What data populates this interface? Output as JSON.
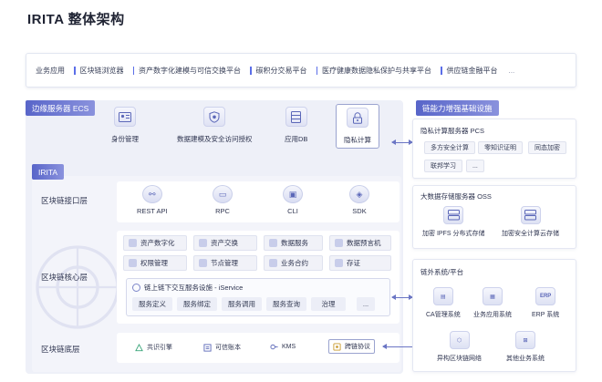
{
  "title": "IRITA 整体架构",
  "business": {
    "label": "业务应用",
    "items": [
      "区块链浏览器",
      "资产数字化建模与可信交换平台",
      "碳积分交易平台",
      "医疗健康数据隐私保护与共享平台",
      "供应链金融平台"
    ],
    "more": "..."
  },
  "ecs": {
    "header": "边缘服务器 ECS",
    "items": [
      "身份管理",
      "数据建模及安全访问授权",
      "应用DB",
      "隐私计算"
    ]
  },
  "irita": {
    "header": "IRITA",
    "api_layer": {
      "label": "区块链接口层",
      "items": [
        "REST API",
        "RPC",
        "CLI",
        "SDK"
      ]
    },
    "core_layer": {
      "label": "区块链核心层",
      "chips": [
        "资产数字化",
        "资产交换",
        "数据服务",
        "数据预言机",
        "权限管理",
        "节点管理",
        "业务合约",
        "存证"
      ],
      "iservice": {
        "title": "链上链下交互服务设施 - iService",
        "items": [
          "服务定义",
          "服务绑定",
          "服务调用",
          "服务查询",
          "治理"
        ],
        "more": "..."
      }
    },
    "base_layer": {
      "label": "区块链底层",
      "items": [
        "共识引擎",
        "可信账本",
        "KMS",
        "跨链协议"
      ]
    }
  },
  "enhance": {
    "header": "链能力增强基础设施",
    "pcs": {
      "title": "隐私计算服务器 PCS",
      "tags": [
        "多方安全计算",
        "零知识证明",
        "同态加密",
        "联邦学习",
        "..."
      ]
    },
    "oss": {
      "title": "大数据存储服务器 OSS",
      "items": [
        "加密 IPFS 分布式存储",
        "加密安全计算云存储"
      ]
    },
    "offchain": {
      "title": "链外系统/平台",
      "items": [
        "CA管理系统",
        "业务应用系统",
        "ERP 系统",
        "异构区块链网络",
        "其他业务系统"
      ]
    }
  },
  "colors": {
    "accent": "#5865c9",
    "panel": "#eef0f8"
  }
}
